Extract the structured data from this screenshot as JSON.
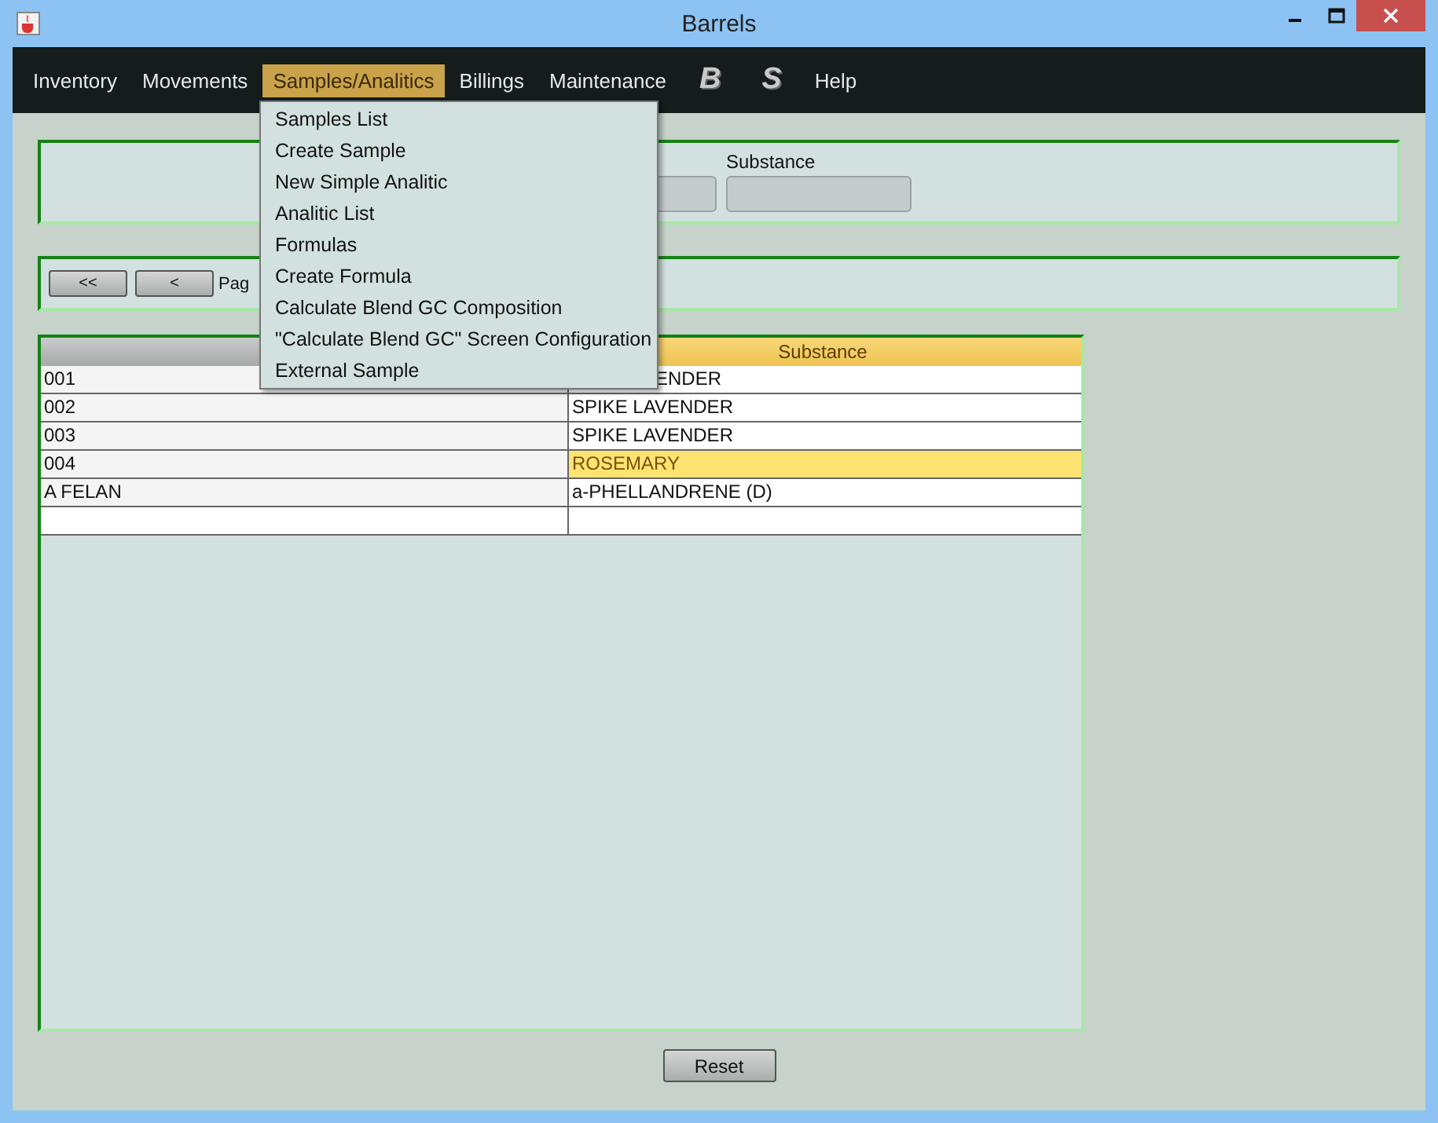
{
  "window": {
    "title": "Barrels"
  },
  "menu_bar": [
    {
      "label": "Inventory",
      "kind": "text",
      "selected": false
    },
    {
      "label": "Movements",
      "kind": "text",
      "selected": false
    },
    {
      "label": "Samples/Analitics",
      "kind": "text",
      "selected": true
    },
    {
      "label": "Billings",
      "kind": "text",
      "selected": false
    },
    {
      "label": "Maintenance",
      "kind": "text",
      "selected": false
    },
    {
      "label": "B",
      "kind": "glyph",
      "selected": false
    },
    {
      "label": "S",
      "kind": "glyph",
      "selected": false
    },
    {
      "label": "Help",
      "kind": "text",
      "selected": false
    }
  ],
  "dropdown": [
    "Samples List",
    "Create Sample",
    "New Simple Analitic",
    "Analitic List",
    "Formulas",
    "Create Formula",
    "Calculate Blend GC Composition",
    "\"Calculate Blend GC\" Screen Configuration",
    "External Sample"
  ],
  "filter": {
    "substance_label": "Substance"
  },
  "pager": {
    "buttons": [
      "<<",
      "<"
    ],
    "label": "Pag"
  },
  "table": {
    "columns": [
      "Substance"
    ],
    "rows": [
      {
        "code": "001",
        "substance": "ENDER",
        "covered": true,
        "selected": false
      },
      {
        "code": "002",
        "substance": "SPIKE LAVENDER",
        "covered": false,
        "selected": false
      },
      {
        "code": "003",
        "substance": "SPIKE LAVENDER",
        "covered": false,
        "selected": false
      },
      {
        "code": "004",
        "substance": "ROSEMARY",
        "covered": false,
        "selected": true
      },
      {
        "code": "A FELAN",
        "substance": "a-PHELLANDRENE (D)",
        "covered": false,
        "selected": false
      }
    ]
  },
  "reset_button": "Reset"
}
